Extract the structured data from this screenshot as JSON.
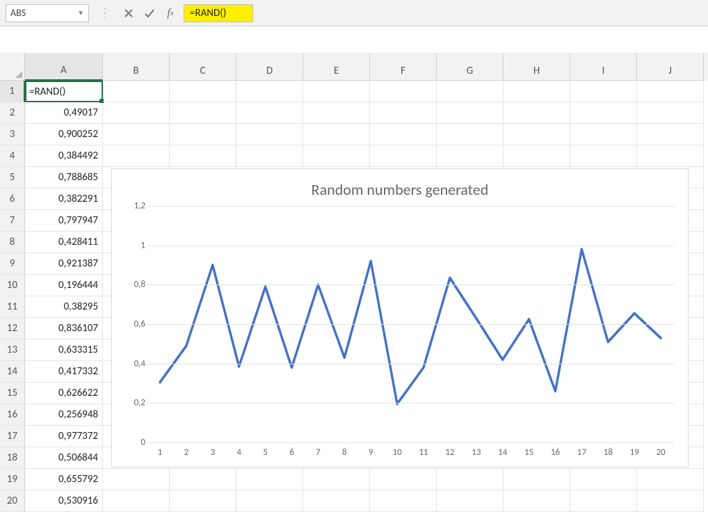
{
  "name_box": "ABS",
  "formula": "=RAND()",
  "columns": [
    "A",
    "B",
    "C",
    "D",
    "E",
    "F",
    "G",
    "H",
    "I",
    "J"
  ],
  "rows": [
    1,
    2,
    3,
    4,
    5,
    6,
    7,
    8,
    9,
    10,
    11,
    12,
    13,
    14,
    15,
    16,
    17,
    18,
    19,
    20
  ],
  "cell_A1": "=RAND()",
  "column_A_values": [
    "0,49017",
    "0,900252",
    "0,384492",
    "0,788685",
    "0,382291",
    "0,797947",
    "0,428411",
    "0,921387",
    "0,196444",
    "0,38295",
    "0,836107",
    "0,633315",
    "0,417332",
    "0,626622",
    "0,256948",
    "0,977372",
    "0,506844",
    "0,655792",
    "0,530916"
  ],
  "chart_data": {
    "type": "line",
    "title": "Random numbers generated",
    "categories": [
      1,
      2,
      3,
      4,
      5,
      6,
      7,
      8,
      9,
      10,
      11,
      12,
      13,
      14,
      15,
      16,
      17,
      18,
      19,
      20
    ],
    "values": [
      0.305,
      0.49,
      0.9,
      0.385,
      0.79,
      0.38,
      0.8,
      0.43,
      0.92,
      0.195,
      0.38,
      0.835,
      0.63,
      0.42,
      0.625,
      0.26,
      0.98,
      0.51,
      0.655,
      0.53
    ],
    "ylim": [
      0,
      1.2
    ],
    "y_ticks": [
      0,
      0.2,
      0.4,
      0.6,
      0.8,
      1,
      1.2
    ],
    "y_tick_labels": [
      "0",
      "0,2",
      "0,4",
      "0,6",
      "0,8",
      "1",
      "1,2"
    ],
    "xlabel": "",
    "ylabel": "",
    "line_color": "#4472c4"
  }
}
